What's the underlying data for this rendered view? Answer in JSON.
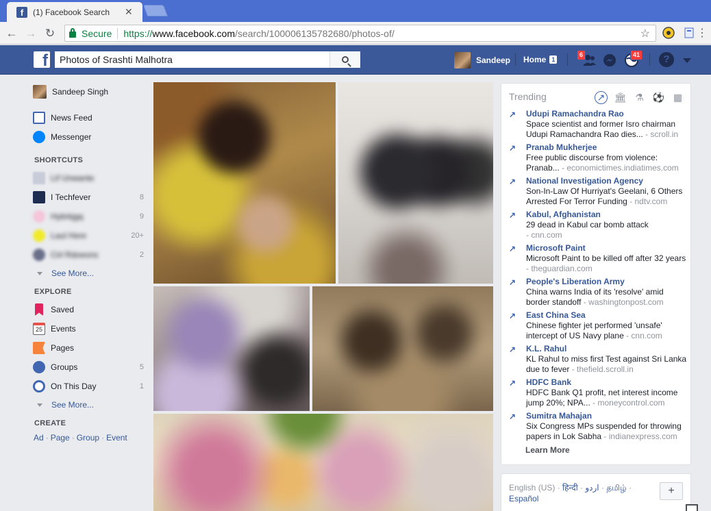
{
  "browser": {
    "tab_title": "(1) Facebook Search",
    "close_glyph": "✕",
    "secure_label": "Secure",
    "url_proto": "https://",
    "url_host": "www.facebook.com",
    "url_path": "/search/100006135782680/photos-of/"
  },
  "fb": {
    "logo_glyph": "f",
    "search_value": "Photos of Srashti Malhotra",
    "user_name": "Sandeep",
    "home_label": "Home",
    "home_count": "1",
    "friend_requests_count": "6",
    "notifications_count": "41",
    "help_glyph": "?"
  },
  "leftnav": {
    "profile_name": "Sandeep Singh",
    "items": [
      {
        "label": "News Feed"
      },
      {
        "label": "Messenger"
      }
    ],
    "shortcuts_header": "SHORTCUTS",
    "shortcuts": [
      {
        "label": "Lif Unwante",
        "count": ""
      },
      {
        "label": "I Techfever",
        "count": "8"
      },
      {
        "label": "Hybrkjgq",
        "count": "9"
      },
      {
        "label": "Laul Here",
        "count": "20+"
      },
      {
        "label": "Cirl Rdoeons",
        "count": "2"
      }
    ],
    "see_more_1": "See More...",
    "explore_header": "EXPLORE",
    "explore": [
      {
        "label": "Saved",
        "count": ""
      },
      {
        "label": "Events",
        "count": "",
        "icon_text": "25"
      },
      {
        "label": "Pages",
        "count": ""
      },
      {
        "label": "Groups",
        "count": "5"
      },
      {
        "label": "On This Day",
        "count": "1"
      }
    ],
    "see_more_2": "See More...",
    "create_header": "CREATE",
    "create_links": [
      "Ad",
      "Page",
      "Group",
      "Event"
    ],
    "create_sep": "·"
  },
  "trending": {
    "header": "Trending",
    "arrow_glyph": "↗",
    "items": [
      {
        "name": "Udupi Ramachandra Rao",
        "desc": "Space scientist and former Isro chairman Udupi Ramachandra Rao dies...",
        "source": " - scroll.in"
      },
      {
        "name": "Pranab Mukherjee",
        "desc": "Free public discourse from violence: Pranab...",
        "source": " - economictimes.indiatimes.com"
      },
      {
        "name": "National Investigation Agency",
        "desc": "Son-In-Law Of Hurriyat's Geelani, 6 Others Arrested For Terror Funding",
        "source": " - ndtv.com"
      },
      {
        "name": "Kabul, Afghanistan",
        "desc": "29 dead in Kabul car bomb attack",
        "source": " - cnn.com"
      },
      {
        "name": "Microsoft Paint",
        "desc": "Microsoft Paint to be killed off after 32 years",
        "source": " - theguardian.com"
      },
      {
        "name": "People's Liberation Army",
        "desc": "China warns India of its 'resolve' amid border standoff",
        "source": " - washingtonpost.com"
      },
      {
        "name": "East China Sea",
        "desc": "Chinese fighter jet performed 'unsafe' intercept of US Navy plane",
        "source": " - cnn.com"
      },
      {
        "name": "K.L. Rahul",
        "desc": "KL Rahul to miss first Test against Sri Lanka due to fever",
        "source": " - thefield.scroll.in"
      },
      {
        "name": "HDFC Bank",
        "desc": "HDFC Bank Q1 profit, net interest income jump 20%; NPA...",
        "source": " - moneycontrol.com"
      },
      {
        "name": "Sumitra Mahajan",
        "desc": "Six Congress MPs suspended for throwing papers in Lok Sabha",
        "source": " - indianexpress.com"
      }
    ],
    "learn_more": "Learn More"
  },
  "languages": {
    "items": [
      "English (US)",
      "हिन्दी",
      "اردو",
      "தமிழ்",
      "Español"
    ],
    "sep": " · ",
    "plus_glyph": "+"
  },
  "colors": {
    "fb_blue": "#3b5998",
    "link_blue": "#365899",
    "badge_red": "#fa3e3e"
  }
}
